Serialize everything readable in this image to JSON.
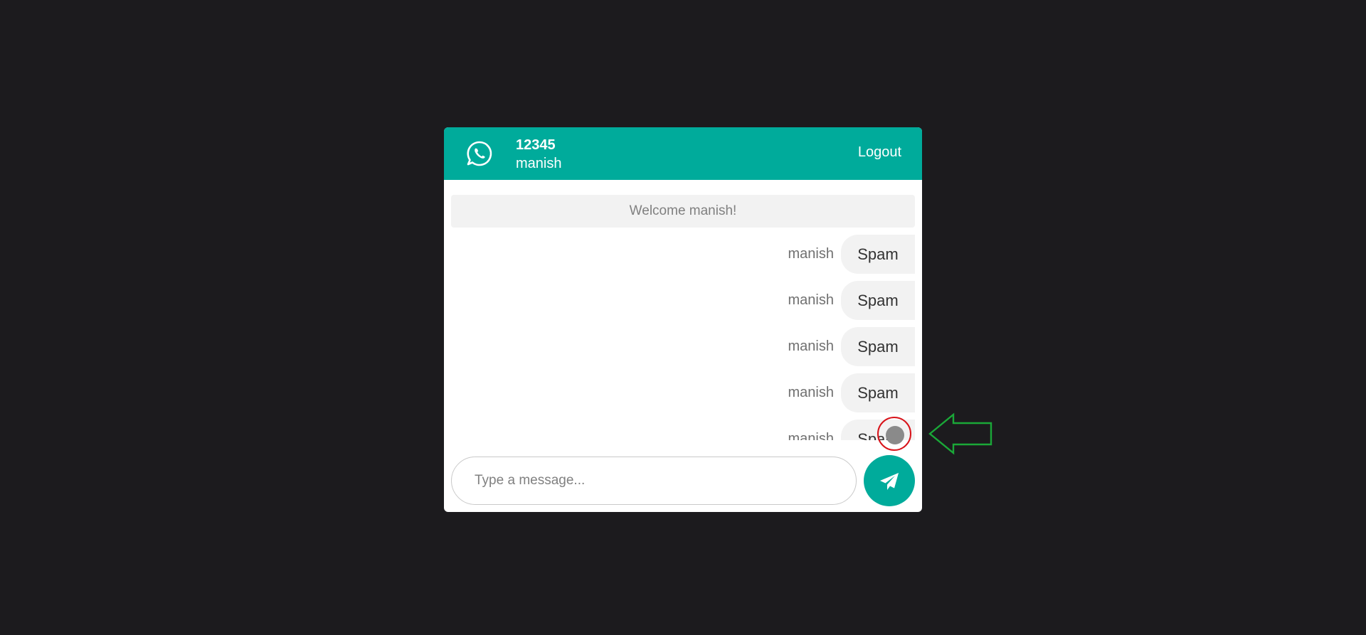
{
  "header": {
    "icon": "whatsapp-icon",
    "room_id": "12345",
    "user_name": "manish",
    "logout_label": "Logout"
  },
  "chat": {
    "welcome_text": "Welcome manish!",
    "messages": [
      {
        "sender": "manish",
        "text": "Spam"
      },
      {
        "sender": "manish",
        "text": "Spam"
      },
      {
        "sender": "manish",
        "text": "Spam"
      },
      {
        "sender": "manish",
        "text": "Spam"
      },
      {
        "sender": "manish",
        "text": "Spam"
      }
    ]
  },
  "composer": {
    "placeholder": "Type a message...",
    "send_icon": "paper-plane-icon"
  },
  "colors": {
    "brand": "#00ab9b",
    "background": "#1c1b1e",
    "bubble": "#f2f2f2",
    "annotation_circle": "#d8131a",
    "annotation_arrow": "#1aa838"
  }
}
